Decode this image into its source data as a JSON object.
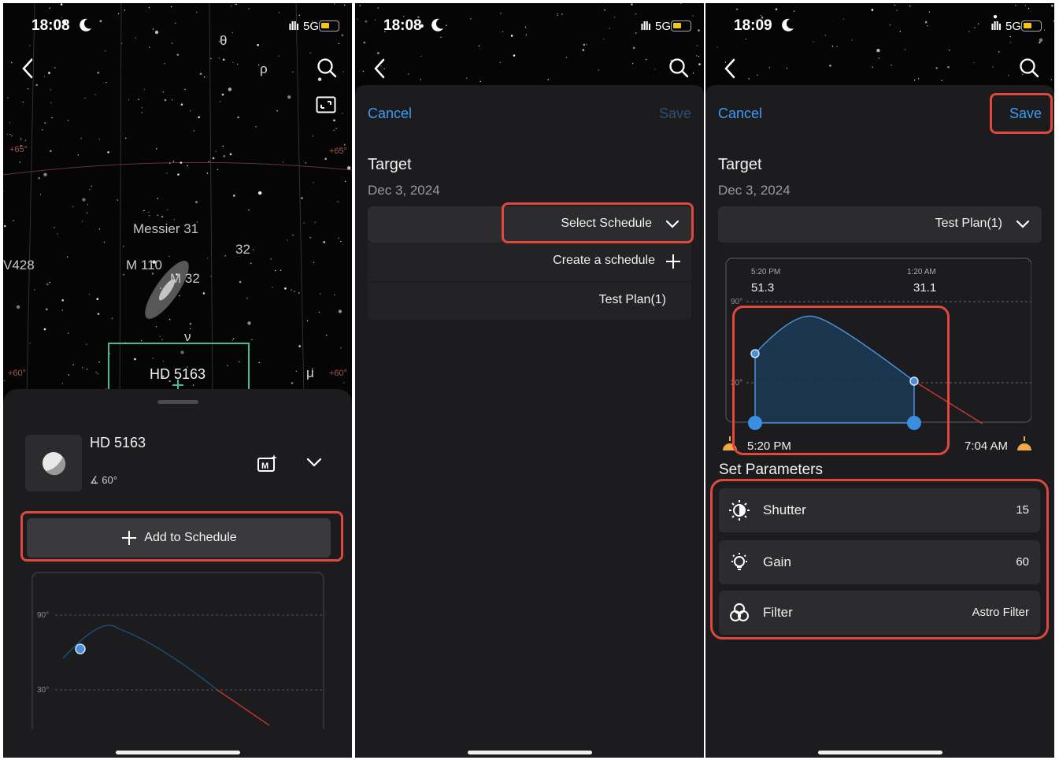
{
  "panels": [
    {
      "status": {
        "time": "18:08",
        "network": "5G"
      },
      "sky": {
        "labels": [
          "Messier 31",
          "M 110",
          "M 32",
          "HD 5163",
          "V428",
          "32"
        ],
        "greek": [
          "θ",
          "ρ",
          "ν",
          "μ"
        ],
        "grid_labels": [
          "+65°",
          "+65°",
          "+60°",
          "+60°"
        ]
      },
      "sheet": {
        "target_name": "HD 5163",
        "altitude": "60°",
        "add_button": "Add to Schedule",
        "chart_ticks": [
          "90°",
          "30°"
        ]
      }
    },
    {
      "status": {
        "time": "18:08",
        "network": "5G"
      },
      "modal": {
        "cancel": "Cancel",
        "save": "Save",
        "title": "Target",
        "date": "Dec 3, 2024",
        "select_label": "Select Schedule",
        "dropdown": [
          "Create a schedule",
          "Test Plan(1)"
        ]
      }
    },
    {
      "status": {
        "time": "18:09",
        "network": "5G"
      },
      "modal": {
        "cancel": "Cancel",
        "save": "Save",
        "title": "Target",
        "date": "Dec 3, 2024",
        "select_label": "Test Plan(1)",
        "chart": {
          "start_time": "5:20 PM",
          "start_alt": "51.3",
          "end_time_label": "1:20 AM",
          "end_alt": "31.1",
          "tick_90": "90°",
          "tick_30": "30°",
          "left_time": "5:20 PM",
          "right_time": "7:04 AM"
        },
        "set_params_title": "Set Parameters",
        "params": [
          {
            "name": "Shutter",
            "value": "15",
            "icon": "shutter-icon"
          },
          {
            "name": "Gain",
            "value": "60",
            "icon": "gain-icon"
          },
          {
            "name": "Filter",
            "value": "Astro Filter",
            "icon": "filter-icon"
          }
        ]
      }
    }
  ],
  "colors": {
    "accent": "#3d9df2",
    "highlight": "#e0483e",
    "sheet": "#1c1c1e",
    "row": "#2c2c2e"
  }
}
